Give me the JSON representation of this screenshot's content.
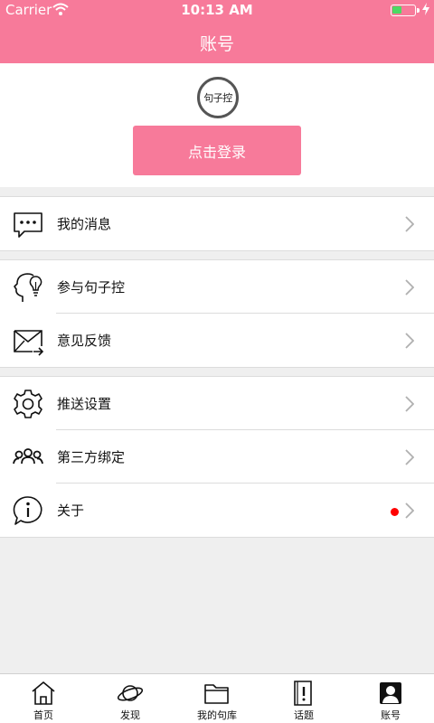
{
  "status_bar": {
    "carrier": "Carrier",
    "time": "10:13 AM"
  },
  "nav": {
    "title": "账号"
  },
  "profile": {
    "avatar_text": "句子控",
    "login_label": "点击登录"
  },
  "menu_groups": [
    {
      "items": [
        {
          "label": "我的消息"
        }
      ]
    },
    {
      "items": [
        {
          "label": "参与句子控"
        },
        {
          "label": "意见反馈"
        }
      ]
    },
    {
      "items": [
        {
          "label": "推送设置"
        },
        {
          "label": "第三方绑定"
        },
        {
          "label": "关于",
          "badge": true
        }
      ]
    }
  ],
  "tabs": [
    {
      "label": "首页",
      "icon": "home-icon"
    },
    {
      "label": "发现",
      "icon": "planet-icon"
    },
    {
      "label": "我的句库",
      "icon": "folder-icon"
    },
    {
      "label": "话题",
      "icon": "topic-icon"
    },
    {
      "label": "账号",
      "icon": "account-icon",
      "active": true
    }
  ],
  "colors": {
    "accent": "#f77a9a",
    "badge": "#ff0000",
    "background": "#efefef"
  }
}
